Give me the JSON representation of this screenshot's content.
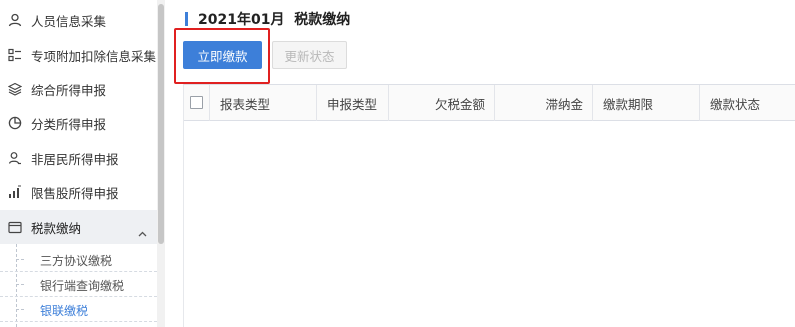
{
  "sidebar": {
    "items": [
      {
        "label": "人员信息采集",
        "icon": "person-icon"
      },
      {
        "label": "专项附加扣除信息采集",
        "icon": "list-icon"
      },
      {
        "label": "综合所得申报",
        "icon": "layers-icon"
      },
      {
        "label": "分类所得申报",
        "icon": "pie-chart-icon"
      },
      {
        "label": "非居民所得申报",
        "icon": "person-outline-icon"
      },
      {
        "label": "限售股所得申报",
        "icon": "bar-chart-icon"
      },
      {
        "label": "税款缴纳",
        "icon": "folder-icon"
      }
    ],
    "sub_items": [
      {
        "label": "三方协议缴税"
      },
      {
        "label": "银行端查询缴税"
      },
      {
        "label": "银联缴税"
      }
    ]
  },
  "main": {
    "title": "2021年01月  税款缴纳",
    "pay_now_label": "立即缴款",
    "refresh_status_label": "更新状态",
    "table": {
      "headers": [
        "报表类型",
        "申报类型",
        "欠税金额",
        "滞纳金",
        "缴款期限",
        "缴款状态"
      ]
    }
  },
  "colors": {
    "accent": "#3d7fd9",
    "highlight": "#e02020"
  }
}
